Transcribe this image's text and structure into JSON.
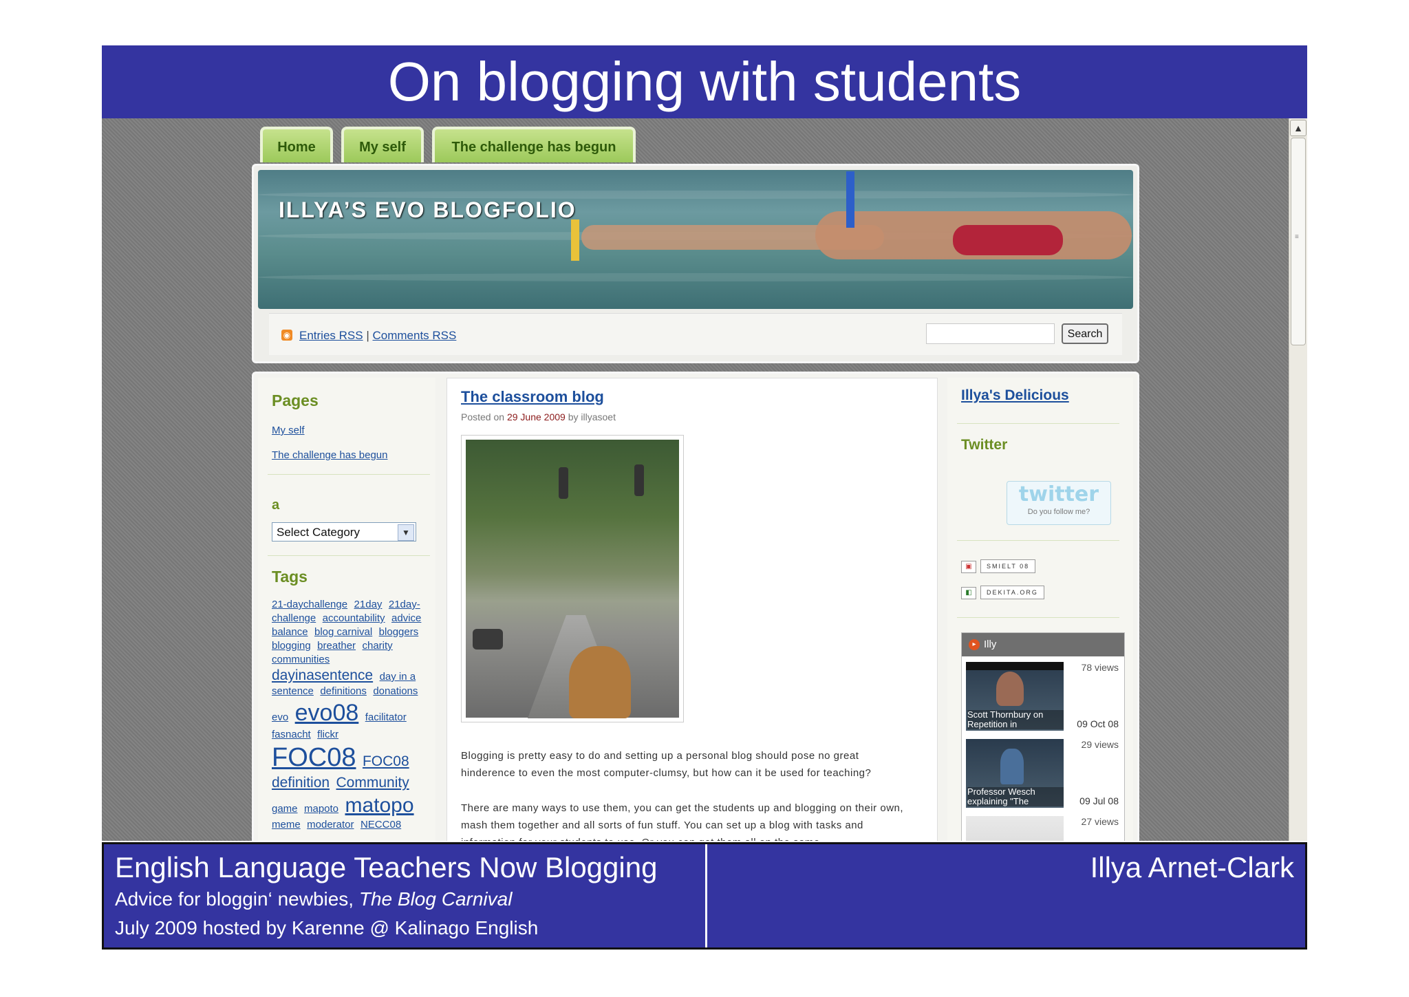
{
  "slide_title": "On blogging with students",
  "nav_tabs": [
    "Home",
    "My self",
    "The challenge has begun"
  ],
  "blog_title": "ILLYA’S EVO BLOGFOLIO",
  "rss": {
    "entries": "Entries RSS",
    "separator": "|",
    "comments": "Comments RSS"
  },
  "search": {
    "button": "Search"
  },
  "left_sidebar": {
    "pages_title": "Pages",
    "pages": [
      "My self",
      "The challenge has begun"
    ],
    "category_title": "a",
    "category_select": "Select Category",
    "tags_title": "Tags",
    "tags": [
      {
        "t": "21-daychallenge",
        "s": 15
      },
      {
        "t": "21day",
        "s": 15
      },
      {
        "t": "21day-",
        "s": 15
      },
      {
        "t": "challenge",
        "s": 15
      },
      {
        "t": "accountability",
        "s": 15
      },
      {
        "t": "advice",
        "s": 15
      },
      {
        "t": "balance",
        "s": 15
      },
      {
        "t": "blog carnival",
        "s": 15
      },
      {
        "t": "bloggers",
        "s": 15
      },
      {
        "t": "blogging",
        "s": 15
      },
      {
        "t": "breather",
        "s": 15
      },
      {
        "t": "charity",
        "s": 15
      },
      {
        "t": "communities",
        "s": 15
      },
      {
        "t": "dayinasentence",
        "s": 21
      },
      {
        "t": "day in a",
        "s": 15
      },
      {
        "t": "sentence",
        "s": 15
      },
      {
        "t": "definitions",
        "s": 15
      },
      {
        "t": "donations",
        "s": 15
      },
      {
        "t": "evo",
        "s": 15
      },
      {
        "t": "evo08",
        "s": 34
      },
      {
        "t": "facilitator",
        "s": 15
      },
      {
        "t": "fasnacht",
        "s": 15
      },
      {
        "t": "flickr",
        "s": 15
      },
      {
        "t": "FOC08",
        "s": 38
      },
      {
        "t": "FOC08",
        "s": 21
      },
      {
        "t": "definition",
        "s": 21
      },
      {
        "t": "Community",
        "s": 21
      },
      {
        "t": "game",
        "s": 15
      },
      {
        "t": "mapoto",
        "s": 15
      },
      {
        "t": "matopo",
        "s": 30
      },
      {
        "t": "meme",
        "s": 15
      },
      {
        "t": "moderator",
        "s": 15
      },
      {
        "t": "NECC08",
        "s": 15
      }
    ]
  },
  "post": {
    "title": "The classroom blog",
    "meta_prefix": "Posted on",
    "date": "29 June 2009",
    "meta_by": "by illyasoet",
    "para1": "Blogging is pretty easy to do and setting up a personal blog should pose no great hinderence to even the most computer-clumsy, but how can it be used for teaching?",
    "para2": "There are many ways to use them, you can get the students up and blogging on their own, mash them together and all sorts of fun stuff. You can set up a blog with tasks and information for your students to use. Or you can get them all on the same"
  },
  "right_sidebar": {
    "delicious": "Illya's Delicious",
    "twitter_title": "Twitter",
    "twitter_logo": "twitter",
    "twitter_sub": "Do you follow me?",
    "badges": [
      "SMIELT 08",
      "DEKITA.ORG"
    ],
    "video_panel": {
      "user": "Illy",
      "videos": [
        {
          "views": "78 views",
          "caption": "Scott Thornbury on Repetition in",
          "date": "09 Oct 08"
        },
        {
          "views": "29 views",
          "caption": "Professor Wesch explaining \"The",
          "date": "09 Jul 08"
        },
        {
          "views": "27 views",
          "caption": "",
          "date": ""
        }
      ]
    }
  },
  "footer": {
    "title": "English Language Teachers Now Blogging",
    "sub1_plain": "Advice for bloggin‘ newbies, ",
    "sub1_italic": "The Blog Carnival",
    "sub2": "July 2009 hosted by Karenne @ Kalinago English",
    "author": "Illya Arnet-Clark"
  }
}
